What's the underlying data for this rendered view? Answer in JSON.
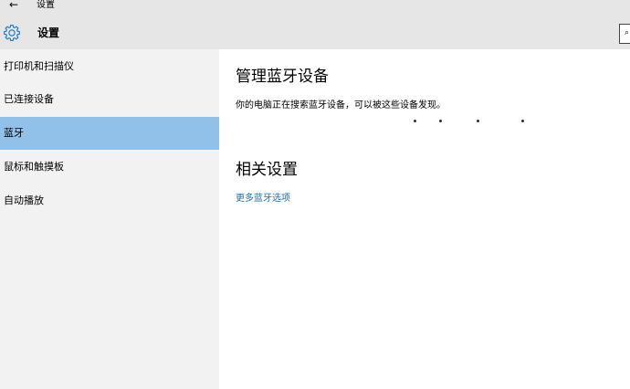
{
  "window": {
    "title": "设置",
    "back_icon": "back-arrow-icon"
  },
  "header": {
    "title": "设置",
    "icon": "gear-icon"
  },
  "sidebar": {
    "items": [
      {
        "label": "打印机和扫描仪",
        "selected": false
      },
      {
        "label": "已连接设备",
        "selected": false
      },
      {
        "label": "蓝牙",
        "selected": true
      },
      {
        "label": "鼠标和触摸板",
        "selected": false
      },
      {
        "label": "自动播放",
        "selected": false
      }
    ]
  },
  "main": {
    "heading": "管理蓝牙设备",
    "status_text": "你的电脑正在搜索蓝牙设备，可以被这些设备发现。",
    "related_heading": "相关设置",
    "more_link": "更多蓝牙选项"
  },
  "colors": {
    "selected_bg": "#91c1e8",
    "link": "#1a6fb3",
    "accent": "#2a7fc9"
  }
}
